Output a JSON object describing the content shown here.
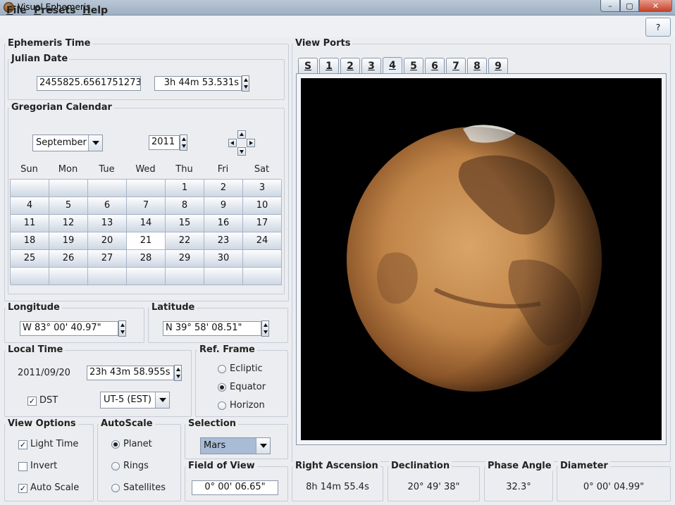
{
  "window": {
    "title": "Visual Ephemeris",
    "min": "–",
    "max": "▢",
    "close": "✕"
  },
  "menu": {
    "file": "File",
    "presets": "Presets",
    "help": "Help",
    "help_button": "?"
  },
  "ephemeris": {
    "group_title": "Ephemeris Time",
    "julian": {
      "title": "Julian Date",
      "value": "2455825.6561751273",
      "time": "3h 44m 53.531s"
    }
  },
  "calendar": {
    "title": "Gregorian Calendar",
    "month": "September",
    "year": "2011",
    "weekdays": [
      "Sun",
      "Mon",
      "Tue",
      "Wed",
      "Thu",
      "Fri",
      "Sat"
    ],
    "weeks": [
      [
        "",
        "",
        "",
        "",
        "1",
        "2",
        "3"
      ],
      [
        "4",
        "5",
        "6",
        "7",
        "8",
        "9",
        "10"
      ],
      [
        "11",
        "12",
        "13",
        "14",
        "15",
        "16",
        "17"
      ],
      [
        "18",
        "19",
        "20",
        "21",
        "22",
        "23",
        "24"
      ],
      [
        "25",
        "26",
        "27",
        "28",
        "29",
        "30",
        ""
      ],
      [
        "",
        "",
        "",
        "",
        "",
        "",
        ""
      ]
    ],
    "selected_day": "21"
  },
  "longitude": {
    "title": "Longitude",
    "value": "W  83°  00'  40.97\""
  },
  "latitude": {
    "title": "Latitude",
    "value": "N  39°  58'  08.51\""
  },
  "local_time": {
    "title": "Local Time",
    "date": "2011/09/20",
    "time": "23h 43m 58.955s",
    "dst_label": "DST",
    "dst_checked": true,
    "timezone": "UT-5 (EST)"
  },
  "ref_frame": {
    "title": "Ref. Frame",
    "options": [
      "Ecliptic",
      "Equator",
      "Horizon"
    ],
    "selected": "Equator"
  },
  "view_options": {
    "title": "View Options",
    "items": [
      {
        "label": "Light Time",
        "checked": true
      },
      {
        "label": "Invert",
        "checked": false
      },
      {
        "label": "Auto Scale",
        "checked": true
      }
    ]
  },
  "autoscale": {
    "title": "AutoScale",
    "options": [
      "Planet",
      "Rings",
      "Satellites"
    ],
    "selected": "Planet"
  },
  "selection": {
    "title": "Selection",
    "value": "Mars"
  },
  "field_of_view": {
    "title": "Field of View",
    "value": "0°  00'  06.65\""
  },
  "view_ports": {
    "title": "View Ports",
    "tabs": [
      "S",
      "1",
      "2",
      "3",
      "4",
      "5",
      "6",
      "7",
      "8",
      "9"
    ],
    "active": "4"
  },
  "readouts": {
    "right_ascension": {
      "title": "Right Ascension",
      "value": "8h 14m 55.4s"
    },
    "declination": {
      "title": "Declination",
      "value": "20°  49'  38\""
    },
    "phase_angle": {
      "title": "Phase Angle",
      "value": "32.3°"
    },
    "diameter": {
      "title": "Diameter",
      "value": "0°  00'  04.99\""
    }
  },
  "colors": {
    "mars_light": "#d19a5e",
    "mars_mid": "#a8693a",
    "mars_dark": "#5a3a22",
    "viewport_bg": "#000000"
  },
  "icons": {
    "app": "mars-globe-icon",
    "spinner": "spinner-arrows-icon",
    "dropdown": "chevron-down-icon",
    "navigator": "four-way-arrows-icon"
  }
}
